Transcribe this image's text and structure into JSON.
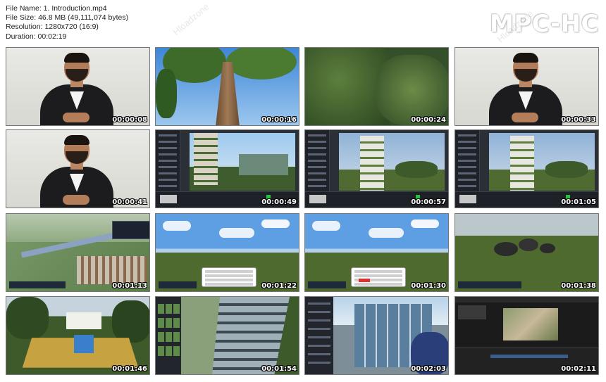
{
  "info": {
    "file_name": "File Name: 1. Introduction.mp4",
    "file_size": "File Size: 46.8 MB (49,111,074 bytes)",
    "resolution": "Resolution: 1280x720 (16:9)",
    "duration": "Duration: 00:02:19"
  },
  "brand": "MPC-HC",
  "watermark": "Hloadzone",
  "thumbnails": [
    {
      "time": "00:00:08",
      "scene": "presenter"
    },
    {
      "time": "00:00:16",
      "scene": "tree"
    },
    {
      "time": "00:00:24",
      "scene": "foliage"
    },
    {
      "time": "00:00:33",
      "scene": "presenter"
    },
    {
      "time": "00:00:41",
      "scene": "presenter"
    },
    {
      "time": "00:00:49",
      "scene": "software-tower-a"
    },
    {
      "time": "00:00:57",
      "scene": "software-tower-b"
    },
    {
      "time": "00:01:05",
      "scene": "software-tower-b"
    },
    {
      "time": "00:01:13",
      "scene": "aerial-city"
    },
    {
      "time": "00:01:22",
      "scene": "grass-keyboard"
    },
    {
      "time": "00:01:30",
      "scene": "grass-keyboard-red"
    },
    {
      "time": "00:01:38",
      "scene": "grass-rocks"
    },
    {
      "time": "00:01:46",
      "scene": "villa-pool"
    },
    {
      "time": "00:01:54",
      "scene": "library-tower"
    },
    {
      "time": "00:02:03",
      "scene": "glass-building"
    },
    {
      "time": "00:02:11",
      "scene": "editor"
    }
  ],
  "colors": {
    "timestamp": "#ffffff",
    "grass": "#4f6a2f",
    "sky": "#5f9fdc",
    "ui_dark": "#2b2f36",
    "accent_green": "#26c43a",
    "accent_red": "#e03030"
  }
}
